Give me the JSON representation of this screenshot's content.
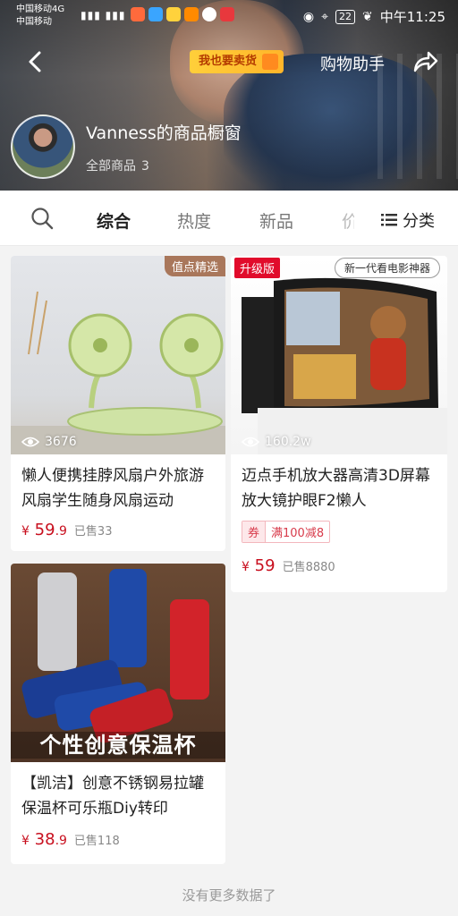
{
  "status_bar": {
    "carrier_line1": "中国移动4G",
    "carrier_line2": "中国移动",
    "battery": "22",
    "time": "中午11:25"
  },
  "header": {
    "sell_badge": "我也要卖货",
    "helper": "购物助手",
    "store_name": "Vanness的商品橱窗",
    "all_items_label": "全部商品",
    "all_items_count": "3"
  },
  "tabs": {
    "items": [
      "综合",
      "热度",
      "新品",
      "价"
    ],
    "active": "综合",
    "category_label": "分类"
  },
  "products": [
    {
      "badge": "值点精选",
      "views": "3676",
      "title": "懒人便携挂脖风扇户外旅游风扇学生随身风扇运动",
      "price_main": "59",
      "price_dec": ".9",
      "sold": "已售33"
    },
    {
      "badge": "升级版",
      "banner": "新一代看电影神器",
      "views": "160.2w",
      "title": "迈点手机放大器高清3D屏幕放大镜护眼F2懒人",
      "coupon_label": "券",
      "coupon_value": "满100减8",
      "price_main": "59",
      "sold": "已售8880"
    },
    {
      "overlay": "个性创意保温杯",
      "title": "【凯洁】创意不锈钢易拉罐保温杯可乐瓶Diy转印",
      "price_main": "38",
      "price_dec": ".9",
      "sold": "已售118"
    }
  ],
  "currency": "¥",
  "footer": "没有更多数据了",
  "colors": {
    "price": "#c80f1e",
    "badge_red": "#e10b2b",
    "sell_badge": "#ffc232"
  }
}
